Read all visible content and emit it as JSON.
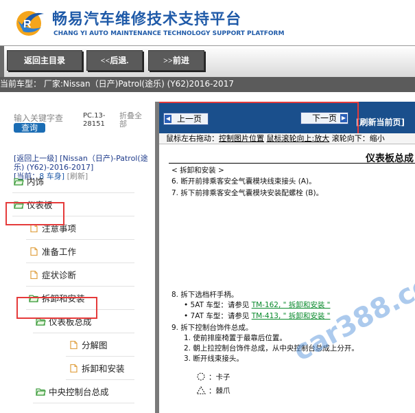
{
  "header": {
    "title_zh": "畅易汽车维修技术支持平台",
    "title_en": "CHANG YI AUTO MAINTENANCE TECHNOLOGY SUPPORT PLATFORM",
    "logo_icon": "cy-logo-icon",
    "brand_color": "#1f5aa8"
  },
  "nav": {
    "home_label": "返回主目录",
    "back_label": "<<后退.",
    "forward_label": ">>前进"
  },
  "current_model": "当前车型： 厂家:Nissan（日产)Patrol(途乐) (Y62)2016-2017",
  "sidebar": {
    "search_placeholder": "输入关键字查",
    "query_label": "查询",
    "pc_code": "PC.13-28151",
    "fold_all": "折叠全部",
    "crumb_back": "[返回上一级]",
    "crumb_path": "[Nissan（日产)-Patrol(途乐) (Y62)-2016-2017]",
    "crumb_current_prefix": "[当前：",
    "crumb_current_value": "8 车身]",
    "crumb_refresh": "[刷新]",
    "tree": [
      {
        "label": "内饰",
        "type": "folder"
      },
      {
        "label": "仪表板",
        "type": "folder"
      },
      {
        "label": "注意事项",
        "type": "doc"
      },
      {
        "label": "准备工作",
        "type": "doc"
      },
      {
        "label": "症状诊断",
        "type": "doc"
      },
      {
        "label": "拆卸和安装",
        "type": "folder"
      },
      {
        "label": "仪表板总成",
        "type": "folder"
      },
      {
        "label": "分解图",
        "type": "doc"
      },
      {
        "label": "拆卸和安装",
        "type": "doc"
      },
      {
        "label": "中央控制台总成",
        "type": "folder"
      }
    ]
  },
  "viewer": {
    "prev_label": "上一页",
    "next_label": "下一页",
    "refresh_label": "[刷新当前页]",
    "hint_prefix": "鼠标左右拖动：",
    "hint_a": "控制图片位置",
    "hint_b": "鼠标滚轮向上:放大",
    "hint_c": "滚轮向下：缩小",
    "doc": {
      "title": "仪表板总成",
      "section": "< 拆卸和安装 >",
      "lines": [
        "6.   断开前排乘客安全气囊模块线束接头 (A)。",
        "7.   拆下前排乘客安全气囊模块安装配螺栓 (B)。"
      ],
      "step8": "8.   拆下选档杆手柄。",
      "step8_a_prefix": "• 5AT 车型：请参见",
      "step8_a_link": "TM-162, \" 拆卸和安装 \"",
      "step8_b_prefix": "• 7AT 车型：请参见",
      "step8_b_link": "TM-413, \" 拆卸和安装 \"",
      "step9": "9.   拆下控制台饰件总成。",
      "step9_1": "1.   使前排座椅置于最靠后位置。",
      "step9_2": "2.   朝上拉控制台饰件总成，从中央控制台总成上分开。",
      "step9_3": "3.   断开线束接头。",
      "legend_clip": "：卡子",
      "legend_pawl": "：棘爪"
    },
    "watermark": "car388.com"
  },
  "colors": {
    "highlight_red": "#e53a3a",
    "toolbar_blue": "#1a4f8c",
    "link_green": "#0a8a2c"
  }
}
